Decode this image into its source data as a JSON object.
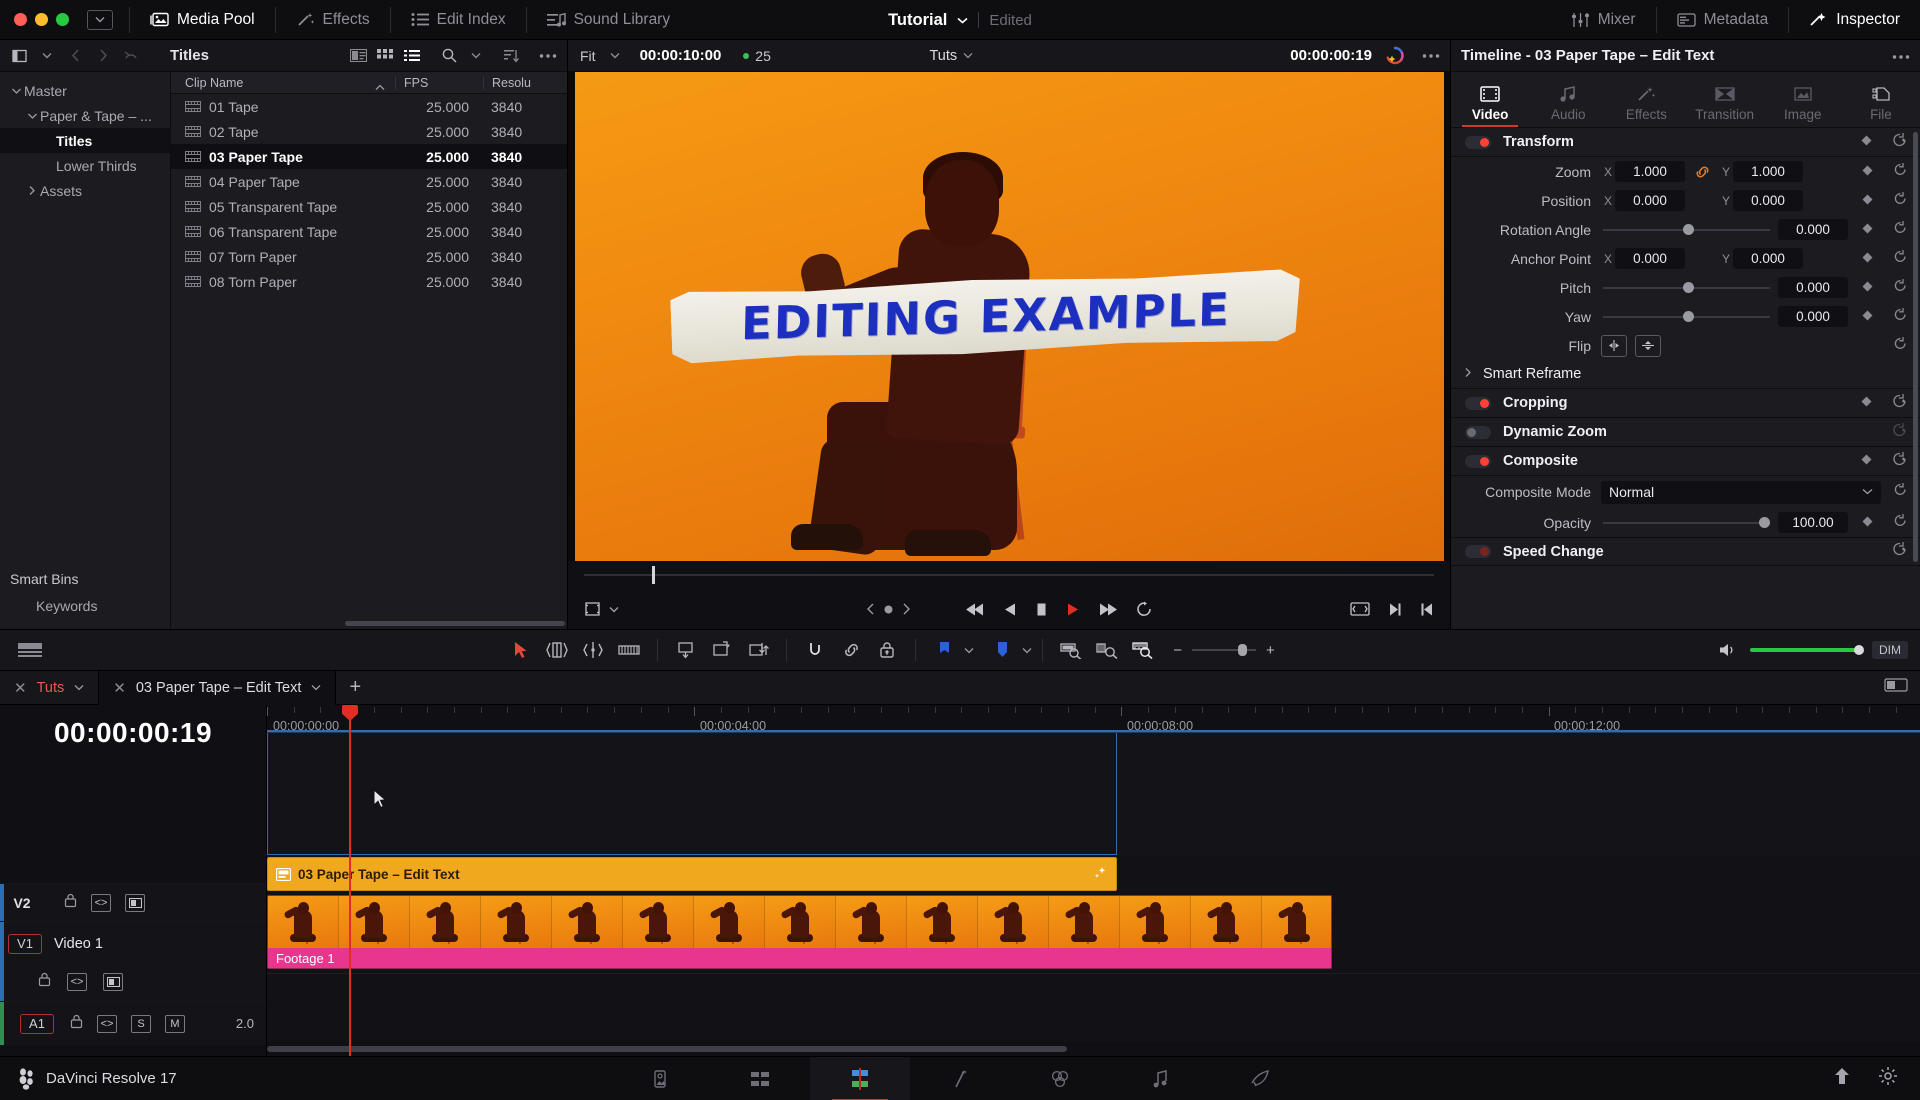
{
  "topbar": {
    "items": [
      {
        "label": "Media Pool",
        "icon": "media-pool-icon",
        "active": true
      },
      {
        "label": "Effects",
        "icon": "effects-wand-icon",
        "active": false
      },
      {
        "label": "Edit Index",
        "icon": "edit-index-icon",
        "active": false
      },
      {
        "label": "Sound Library",
        "icon": "sound-library-icon",
        "active": false
      }
    ],
    "project_name": "Tutorial",
    "project_status": "Edited",
    "right_items": [
      {
        "label": "Mixer",
        "icon": "mixer-icon"
      },
      {
        "label": "Metadata",
        "icon": "metadata-icon"
      },
      {
        "label": "Inspector",
        "icon": "inspector-icon",
        "active": true
      }
    ]
  },
  "media_pool": {
    "title": "Titles",
    "tree": [
      {
        "label": "Master",
        "depth": 0,
        "chevron": "down",
        "selected": false
      },
      {
        "label": "Paper & Tape – ...",
        "depth": 1,
        "chevron": "down",
        "selected": false
      },
      {
        "label": "Titles",
        "depth": 2,
        "chevron": "none",
        "selected": true
      },
      {
        "label": "Lower Thirds",
        "depth": 2,
        "chevron": "none",
        "selected": false
      },
      {
        "label": "Assets",
        "depth": 1,
        "chevron": "right",
        "selected": false
      }
    ],
    "smart_bins_header": "Smart Bins",
    "smart_bins_items": [
      "Keywords"
    ],
    "columns": [
      "Clip Name",
      "FPS",
      "Resolu"
    ],
    "clips": [
      {
        "name": "01 Tape",
        "fps": "25.000",
        "resolution": "3840",
        "selected": false
      },
      {
        "name": "02 Tape",
        "fps": "25.000",
        "resolution": "3840",
        "selected": false
      },
      {
        "name": "03 Paper Tape",
        "fps": "25.000",
        "resolution": "3840",
        "selected": true
      },
      {
        "name": "04 Paper Tape",
        "fps": "25.000",
        "resolution": "3840",
        "selected": false
      },
      {
        "name": "05 Transparent Tape",
        "fps": "25.000",
        "resolution": "3840",
        "selected": false
      },
      {
        "name": "06 Transparent Tape",
        "fps": "25.000",
        "resolution": "3840",
        "selected": false
      },
      {
        "name": "07 Torn Paper",
        "fps": "25.000",
        "resolution": "3840",
        "selected": false
      },
      {
        "name": "08 Torn Paper",
        "fps": "25.000",
        "resolution": "3840",
        "selected": false
      }
    ]
  },
  "viewer": {
    "fit_label": "Fit",
    "duration_timecode": "00:00:10:00",
    "fps_label": "25",
    "source_label": "Tuts",
    "current_timecode": "00:00:00:19",
    "preview_text": "EDITING EXAMPLE"
  },
  "inspector": {
    "title": "Timeline - 03 Paper Tape – Edit Text",
    "tabs": [
      {
        "label": "Video",
        "icon": "film-icon",
        "active": true
      },
      {
        "label": "Audio",
        "icon": "music-note-icon",
        "active": false
      },
      {
        "label": "Effects",
        "icon": "magic-wand-icon",
        "active": false
      },
      {
        "label": "Transition",
        "icon": "transition-icon",
        "active": false
      },
      {
        "label": "Image",
        "icon": "image-icon",
        "active": false
      },
      {
        "label": "File",
        "icon": "file-stack-icon",
        "active": false
      }
    ],
    "sections": {
      "transform": {
        "name": "Transform",
        "enabled": true,
        "params": [
          {
            "label": "Zoom",
            "type": "xy",
            "x": "1.000",
            "y": "1.000",
            "linked": true
          },
          {
            "label": "Position",
            "type": "xy",
            "x": "0.000",
            "y": "0.000",
            "linked": false
          },
          {
            "label": "Rotation Angle",
            "type": "slider",
            "value": "0.000"
          },
          {
            "label": "Anchor Point",
            "type": "xy",
            "x": "0.000",
            "y": "0.000",
            "linked": false
          },
          {
            "label": "Pitch",
            "type": "slider",
            "value": "0.000"
          },
          {
            "label": "Yaw",
            "type": "slider",
            "value": "0.000"
          },
          {
            "label": "Flip",
            "type": "flip"
          }
        ]
      },
      "smart_reframe": {
        "name": "Smart Reframe",
        "collapsed": true
      },
      "cropping": {
        "name": "Cropping",
        "enabled": true
      },
      "dynamic_zoom": {
        "name": "Dynamic Zoom",
        "enabled": false
      },
      "composite": {
        "name": "Composite",
        "enabled": true,
        "mode_label": "Composite Mode",
        "mode_value": "Normal",
        "opacity_label": "Opacity",
        "opacity_value": "100.00"
      },
      "speed_change": {
        "name": "Speed Change",
        "enabled": true
      }
    }
  },
  "edit_toolbar": {
    "tools": [
      "selection-arrow-icon",
      "trim-edit-icon",
      "dynamic-trim-icon",
      "blade-edit-icon",
      "insert-clip-icon",
      "overwrite-clip-icon",
      "replace-clip-icon",
      "snapping-icon",
      "linked-selection-icon",
      "lock-track-icon",
      "flag-icon",
      "marker-icon",
      "zoom-to-fit-icon",
      "detail-zoom-icon",
      "custom-zoom-icon"
    ],
    "dim_label": "DIM"
  },
  "timeline": {
    "tabs": [
      {
        "label": "Tuts",
        "current": true
      },
      {
        "label": "03 Paper Tape – Edit Text",
        "active": true
      }
    ],
    "add_tab": "+",
    "playhead_timecode": "00:00:00:19",
    "ruler_marks": [
      "00:00:00:00",
      "00:00:04:00",
      "00:00:08:00",
      "00:00:12:00"
    ],
    "tracks": [
      {
        "id": "V2",
        "name": "",
        "volume": "",
        "type": "video"
      },
      {
        "id": "V1",
        "name": "Video 1",
        "volume": "",
        "type": "video"
      },
      {
        "id": "A1",
        "name": "",
        "volume": "2.0",
        "type": "audio",
        "solo": "S",
        "mute": "M"
      }
    ],
    "clips": [
      {
        "track": "V2",
        "label": "03 Paper Tape – Edit Text",
        "color": "#f0a91e"
      },
      {
        "track": "V1",
        "label": "Footage 1",
        "color": "#e8368f"
      }
    ]
  },
  "bottom_bar": {
    "brand": "DaVinci Resolve 17",
    "pages": [
      {
        "name": "media-page",
        "icon": "media-icon",
        "active": false
      },
      {
        "name": "cut-page",
        "icon": "cut-icon",
        "active": false
      },
      {
        "name": "edit-page",
        "icon": "edit-icon",
        "active": true
      },
      {
        "name": "fusion-page",
        "icon": "fusion-icon",
        "active": false
      },
      {
        "name": "color-page",
        "icon": "color-icon",
        "active": false
      },
      {
        "name": "fairlight-page",
        "icon": "fairlight-icon",
        "active": false
      },
      {
        "name": "deliver-page",
        "icon": "deliver-icon",
        "active": false
      }
    ],
    "right_icons": [
      "project-manager-icon",
      "project-settings-icon"
    ]
  },
  "colors": {
    "accent_red": "#d9342b",
    "title_clip": "#f0a91e",
    "footage_clip": "#e8368f",
    "playhead": "#e02e24",
    "selection_blue": "#2a6fb5"
  }
}
